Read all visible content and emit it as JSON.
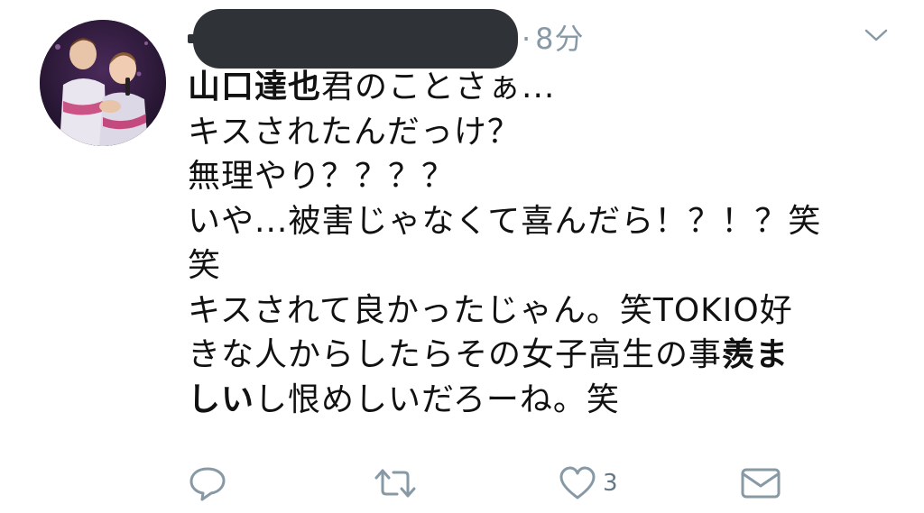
{
  "tweet": {
    "time": "8分",
    "body": {
      "line1_bold": "山口達也",
      "line1_rest": "君のことさぁ...",
      "line2": "キスされたんだっけ？",
      "line3": "無理やり？？？？",
      "line4": "いや...被害じゃなくて喜んだら！？！？笑",
      "line5": "笑",
      "line6": "キスされて良かったじゃん。笑TOKIO好",
      "line7_pre": "きな人からしたらその女子高生の事",
      "line7_bold": "羨ま",
      "line8_bold": "しい",
      "line8_rest": "し恨めしいだろーね。笑"
    },
    "actions": {
      "reply_icon": "reply-icon",
      "retweet_icon": "retweet-icon",
      "like_icon": "heart-icon",
      "like_count": "3",
      "dm_icon": "envelope-icon"
    }
  },
  "colors": {
    "icon_gray": "#8899a6",
    "redaction": "#2f3337",
    "text": "#111111"
  }
}
